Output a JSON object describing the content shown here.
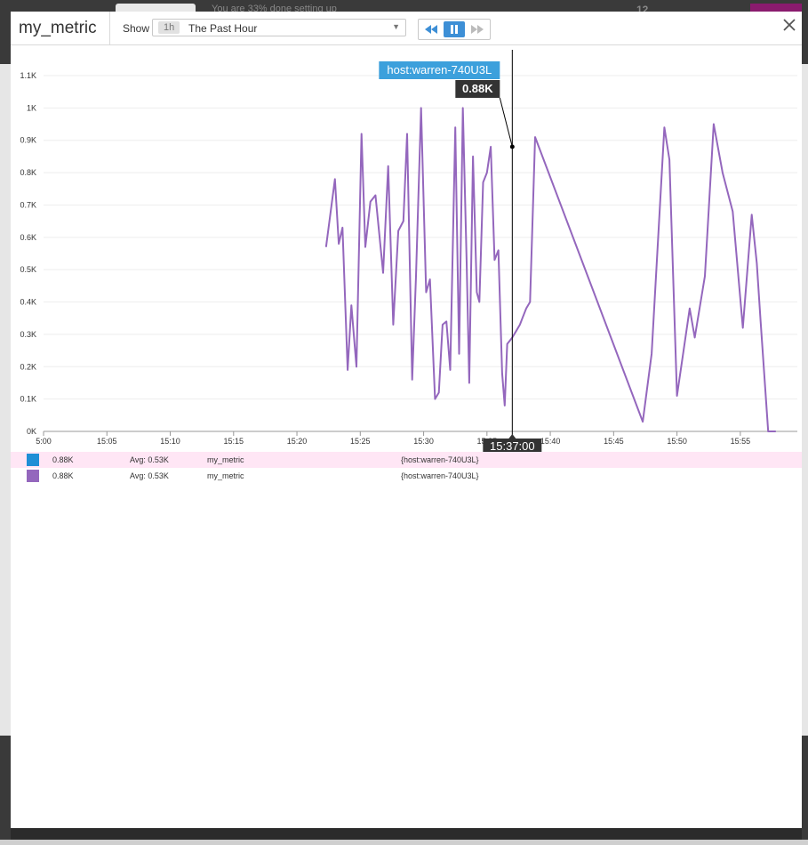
{
  "background": {
    "text": "You are 33% done setting up",
    "count": "12"
  },
  "modal": {
    "title": "my_metric",
    "show_label": "Show",
    "timeframe": {
      "badge": "1h",
      "label": "The Past Hour"
    },
    "colors": {
      "accent": "#3d8fd6",
      "series": "#9467bd",
      "tooltip_host_bg": "#3ca0dc",
      "tooltip_value_bg": "#333333"
    }
  },
  "chart_data": {
    "type": "line",
    "title": "my_metric",
    "xlabel": "",
    "ylabel": "",
    "ylim": [
      0,
      1.1
    ],
    "y_unit": "K",
    "yticks": [
      "0K",
      "0.1K",
      "0.2K",
      "0.3K",
      "0.4K",
      "0.5K",
      "0.6K",
      "0.7K",
      "0.8K",
      "0.9K",
      "1K",
      "1.1K"
    ],
    "xticks": [
      "5:00",
      "15:05",
      "15:10",
      "15:15",
      "15:20",
      "15:25",
      "15:30",
      "15:35",
      "15:40",
      "15:45",
      "15:50",
      "15:55"
    ],
    "grid": true,
    "series": [
      {
        "name": "my_metric {host:warren-740U3L}",
        "x_minutes_after_1500": [
          22.3,
          23.0,
          23.3,
          23.6,
          24.0,
          24.3,
          24.7,
          25.1,
          25.4,
          25.8,
          26.2,
          26.8,
          27.2,
          27.6,
          28.0,
          28.4,
          28.7,
          29.1,
          29.4,
          29.8,
          30.2,
          30.5,
          30.9,
          31.2,
          31.5,
          31.8,
          32.1,
          32.5,
          32.8,
          33.1,
          33.4,
          33.6,
          33.9,
          34.2,
          34.4,
          34.7,
          35.0,
          35.3,
          35.6,
          35.9,
          36.2,
          36.4,
          36.6,
          37.0,
          37.3,
          37.6,
          37.8,
          38.1,
          38.4,
          38.8,
          47.3,
          48.0,
          49.0,
          49.4,
          50.0,
          51.0,
          51.4,
          52.2,
          52.9,
          53.6,
          54.4,
          55.2,
          55.9,
          56.3,
          56.6,
          57.2,
          57.8
        ],
        "values": [
          0.57,
          0.78,
          0.58,
          0.63,
          0.19,
          0.39,
          0.2,
          0.92,
          0.57,
          0.71,
          0.73,
          0.49,
          0.82,
          0.33,
          0.62,
          0.65,
          0.92,
          0.16,
          0.48,
          1.0,
          0.43,
          0.47,
          0.1,
          0.12,
          0.33,
          0.34,
          0.19,
          0.94,
          0.24,
          1.0,
          0.52,
          0.15,
          0.85,
          0.43,
          0.4,
          0.77,
          0.8,
          0.88,
          0.53,
          0.56,
          0.18,
          0.08,
          0.27,
          0.29,
          0.31,
          0.33,
          0.35,
          0.38,
          0.4,
          0.91,
          0.03,
          0.24,
          0.94,
          0.84,
          0.11,
          0.38,
          0.29,
          0.48,
          0.95,
          0.8,
          0.68,
          0.32,
          0.67,
          0.52,
          0.34,
          0.0,
          0.0
        ],
        "color": "#9467bd"
      }
    ],
    "tooltip": {
      "host": "host:warren-740U3L",
      "value": "0.88K",
      "time": "15:37:00",
      "x_min": 37.0,
      "y": 0.88
    }
  },
  "legend": [
    {
      "color": "#1f8fd6",
      "value": "0.88K",
      "avg": "Avg: 0.53K",
      "metric": "my_metric",
      "scope": "{host:warren-740U3L}"
    },
    {
      "color": "#9467bd",
      "value": "0.88K",
      "avg": "Avg: 0.53K",
      "metric": "my_metric",
      "scope": "{host:warren-740U3L}"
    }
  ]
}
